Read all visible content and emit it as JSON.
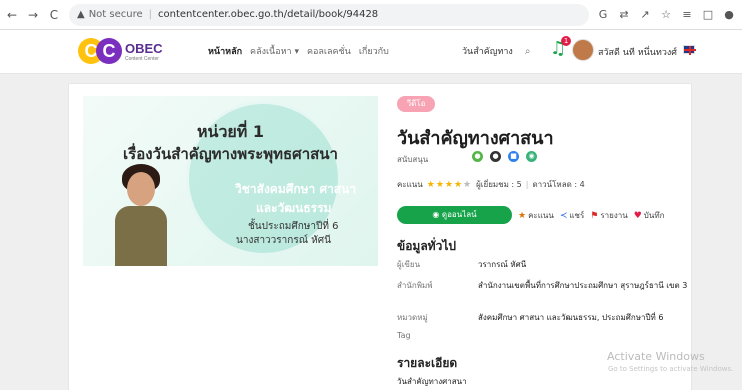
{
  "browser": {
    "security": "Not secure",
    "url": "contentcenter.obec.go.th/detail/book/94428"
  },
  "header": {
    "logo_text": "OBEC",
    "logo_sub": "Content Center",
    "nav": [
      "หน้าหลัก",
      "คลังเนื้อหา ▾",
      "คอลเลคชั่น",
      "เกี่ยวกับ"
    ],
    "search_value": "วันสำคัญทาง",
    "notification_count": "1",
    "greeting": "สวัสดี นที หนึ่นทวงศ์"
  },
  "cover": {
    "title1": "หน่วยที่ 1",
    "title2": "เรื่องวันสำคัญทางพระพุทธศาสนา",
    "sub1": "วิชาสังคมศึกษา ศาสนา",
    "sub2": "และวัฒนธรรม",
    "line3": "ชั้นประถมศึกษาปีที่ 6",
    "line4": "นางสาววรากรณ์ หัศนี"
  },
  "detail": {
    "type_badge": "วีดีโอ",
    "title": "วันสำคัญทางศาสนา",
    "support_label": "สนับสนุน",
    "rating_label": "คะแนน",
    "rating": 4,
    "views": "ผู้เยี่ยมชม : 5",
    "downloads": "ดาวน์โหลด : 4",
    "btn_online": "ดูออนไลน์",
    "btn_rate": "คะแนน",
    "btn_share": "แชร์",
    "btn_report": "รายงาน",
    "btn_save": "บันทึก"
  },
  "general": {
    "title": "ข้อมูลทั่วไป",
    "author_label": "ผู้เขียน",
    "author": "วรากรณ์ หัศนี",
    "publisher_label": "สำนักพิมพ์",
    "publisher": "สำนักงานเขตพื้นที่การศึกษาประถมศึกษา สุราษฎร์ธานี เขต 3",
    "category_label": "หมวดหมู่",
    "category": "สังคมศึกษา ศาสนา และวัฒนธรรม, ประถมศึกษาปีที่ 6",
    "tag_label": "Tag"
  },
  "description": {
    "title": "รายละเอียด",
    "text": "วันสำคัญทางศาสนา"
  },
  "windows": {
    "line1": "Activate Windows",
    "line2": "Go to Settings to activate Windows."
  }
}
